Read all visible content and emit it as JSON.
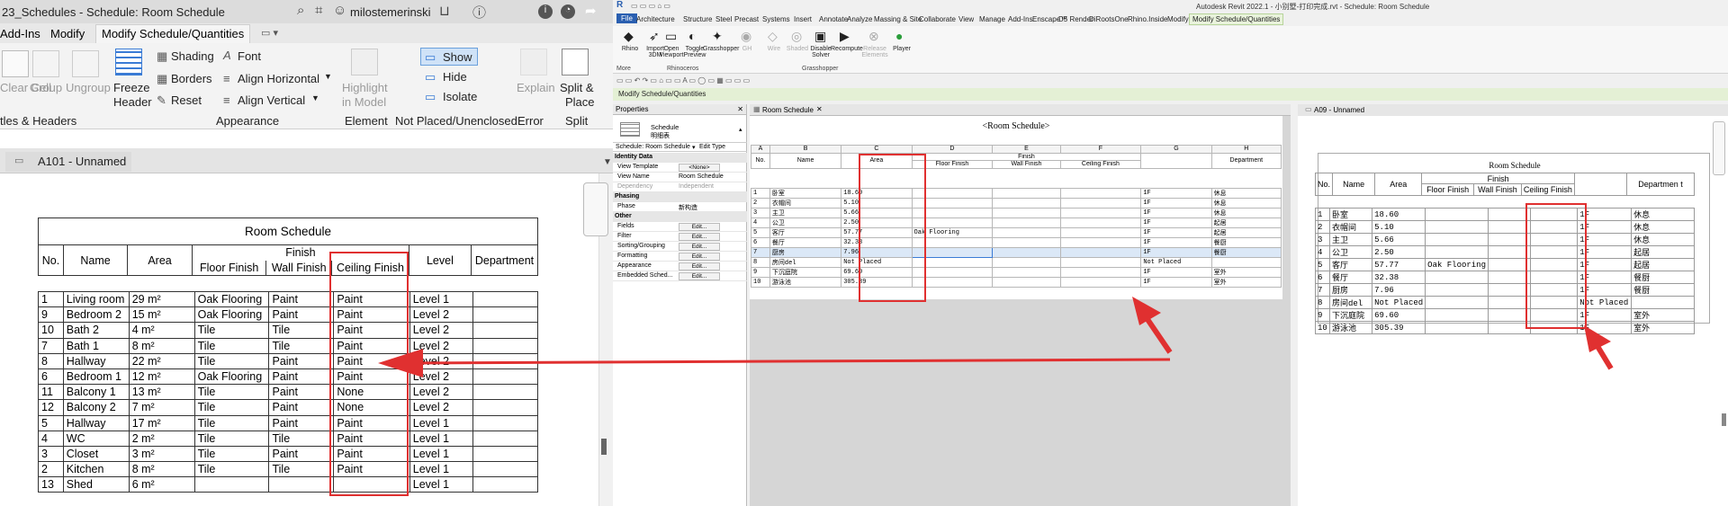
{
  "left": {
    "window_title": "23_Schedules - Schedule: Room Schedule",
    "user": "milostemerinski",
    "tabs": [
      "Add-Ins",
      "Modify",
      "Modify Schedule/Quantities"
    ],
    "ribbon": {
      "clear_cell": "Clear Cell",
      "group": "Group",
      "ungroup": "Ungroup",
      "freeze_header_1": "Freeze",
      "freeze_header_2": "Header",
      "shading": "Shading",
      "font": "Font",
      "borders": "Borders",
      "align_horizontal": "Align  Horizontal",
      "reset": "Reset",
      "align_vertical": "Align  Vertical",
      "highlight_1": "Highlight",
      "highlight_2": "in Model",
      "show": "Show",
      "hide": "Hide",
      "isolate": "Isolate",
      "explain": "Explain",
      "split_1": "Split &",
      "split_2": "Place"
    },
    "panels": [
      "tles & Headers",
      "Appearance",
      "Element",
      "Not Placed/Unenclosed",
      "Error",
      "Split"
    ],
    "view_tab": "A101 - Unnamed",
    "schedule": {
      "title": "Room Schedule",
      "group_header": "Finish",
      "headers": [
        "No.",
        "Name",
        "Area",
        "Floor Finish",
        "Wall Finish",
        "Ceiling Finish",
        "Level",
        "Department"
      ],
      "rows": [
        [
          "1",
          "Living room",
          "29 m²",
          "Oak Flooring",
          "Paint",
          "Paint",
          "Level 1",
          ""
        ],
        [
          "9",
          "Bedroom 2",
          "15 m²",
          "Oak Flooring",
          "Paint",
          "Paint",
          "Level 2",
          ""
        ],
        [
          "10",
          "Bath 2",
          "4 m²",
          "Tile",
          "Tile",
          "Paint",
          "Level 2",
          ""
        ],
        [
          "7",
          "Bath 1",
          "8 m²",
          "Tile",
          "Tile",
          "Paint",
          "Level 2",
          ""
        ],
        [
          "8",
          "Hallway",
          "22 m²",
          "Tile",
          "Paint",
          "Paint",
          "Level 2",
          ""
        ],
        [
          "6",
          "Bedroom 1",
          "12 m²",
          "Oak Flooring",
          "Paint",
          "Paint",
          "Level 2",
          ""
        ],
        [
          "11",
          "Balcony 1",
          "13 m²",
          "Tile",
          "Paint",
          "None",
          "Level 2",
          ""
        ],
        [
          "12",
          "Balcony 2",
          "7 m²",
          "Tile",
          "Paint",
          "None",
          "Level 2",
          ""
        ],
        [
          "5",
          "Hallway",
          "17 m²",
          "Tile",
          "Paint",
          "Paint",
          "Level 1",
          ""
        ],
        [
          "4",
          "WC",
          "2 m²",
          "Tile",
          "Tile",
          "Paint",
          "Level 1",
          ""
        ],
        [
          "3",
          "Closet",
          "3 m²",
          "Tile",
          "Paint",
          "Paint",
          "Level 1",
          ""
        ],
        [
          "2",
          "Kitchen",
          "8 m²",
          "Tile",
          "Tile",
          "Paint",
          "Level 1",
          ""
        ],
        [
          "13",
          "Shed",
          "6 m²",
          "",
          "",
          "",
          "Level 1",
          ""
        ]
      ]
    }
  },
  "right": {
    "window_title": "Autodesk Revit 2022.1 - 小别墅-打印完成.rvt - Schedule: Room Schedule",
    "tabs": [
      "File",
      "Architecture",
      "Structure",
      "Steel",
      "Precast",
      "Systems",
      "Insert",
      "Annotate",
      "Analyze",
      "Massing & Site",
      "Collaborate",
      "View",
      "Manage",
      "Add-Ins",
      "Enscape™",
      "D5 Render",
      "DiRootsOne",
      "Rhino.Inside",
      "Modify",
      "Modify Schedule/Quantities"
    ],
    "ribbon_tools": [
      "Rhino",
      "Import 3DM",
      "Open Viewport",
      "Toggle Preview",
      "Grasshopper",
      "GH",
      "Wire",
      "Shaded",
      "Disable Solver",
      "Recompute",
      "Release Elements",
      "Player"
    ],
    "ribbon_groups": [
      "More",
      "Rhinoceros",
      "Grasshopper"
    ],
    "context_bar": "Modify Schedule/Quantities",
    "properties": {
      "title": "Properties",
      "type_name": "Schedule",
      "type_sub": "明细表",
      "selector": "Schedule: Room Schedule",
      "edit_type": "Edit Type",
      "groups": {
        "identity": "Identity Data",
        "phasing": "Phasing",
        "other": "Other"
      },
      "rows": [
        [
          "View Template",
          "<None>"
        ],
        [
          "View Name",
          "Room Schedule"
        ],
        [
          "Dependency",
          "Independent"
        ],
        [
          "Phase",
          "新构造"
        ],
        [
          "Fields",
          "Edit..."
        ],
        [
          "Filter",
          "Edit..."
        ],
        [
          "Sorting/Grouping",
          "Edit..."
        ],
        [
          "Formatting",
          "Edit..."
        ],
        [
          "Appearance",
          "Edit..."
        ],
        [
          "Embedded Sched...",
          "Edit..."
        ]
      ]
    },
    "schedule_tab": "Room Schedule",
    "schedule": {
      "title": "<Room Schedule>",
      "col_letters": [
        "A",
        "B",
        "C",
        "D",
        "E",
        "F",
        "G",
        "H"
      ],
      "group_header": "Finish",
      "headers": [
        "No.",
        "Name",
        "Area",
        "Floor Finish",
        "Wall Finish",
        "Ceiling Finish",
        "",
        "Department"
      ],
      "rows": [
        [
          "1",
          "卧室",
          "18.60",
          "",
          "",
          "",
          "1F",
          "休息"
        ],
        [
          "2",
          "衣帽间",
          "5.10",
          "",
          "",
          "",
          "1F",
          "休息"
        ],
        [
          "3",
          "主卫",
          "5.66",
          "",
          "",
          "",
          "1F",
          "休息"
        ],
        [
          "4",
          "公卫",
          "2.50",
          "",
          "",
          "",
          "1F",
          "起居"
        ],
        [
          "5",
          "客厅",
          "57.77",
          "Oak Flooring",
          "",
          "",
          "1F",
          "起居"
        ],
        [
          "6",
          "餐厅",
          "32.38",
          "",
          "",
          "",
          "1F",
          "餐厨"
        ],
        [
          "7",
          "厨房",
          "7.96",
          "",
          "",
          "",
          "1F",
          "餐厨"
        ],
        [
          "8",
          "房间del",
          "Not Placed",
          "",
          "",
          "",
          "Not Placed",
          ""
        ],
        [
          "9",
          "下沉庭院",
          "69.60",
          "",
          "",
          "",
          "1F",
          "室外"
        ],
        [
          "10",
          "游泳池",
          "305.39",
          "",
          "",
          "",
          "1F",
          "室外"
        ]
      ]
    },
    "view_tab": "A09 - Unnamed",
    "view_schedule": {
      "title": "Room Schedule",
      "group_header": "Finish",
      "headers": [
        "No.",
        "Name",
        "Area",
        "Floor Finish",
        "Wall Finish",
        "Ceiling Finish",
        "",
        "Departmen t"
      ]
    }
  },
  "colors": {
    "annotation_red": "#e03030",
    "revit_context_green": "#e4f0d5",
    "revit_file_blue": "#2a5fb0"
  }
}
